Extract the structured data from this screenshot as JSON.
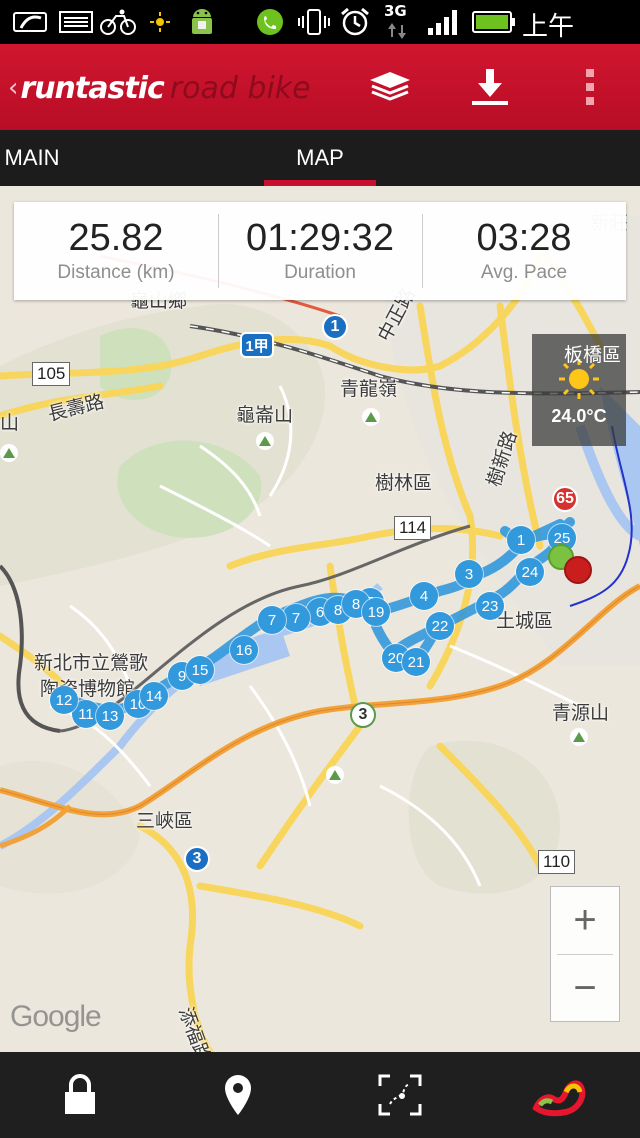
{
  "status_bar": {
    "network": "3G",
    "time": "上午11:11",
    "icons": [
      "photo-icon",
      "mail-icon",
      "cycling-icon",
      "sun-icon",
      "android-icon",
      "phone-icon",
      "vibrate-icon",
      "alarm-icon",
      "signal-icon",
      "battery-icon"
    ]
  },
  "app_bar": {
    "brand_primary": "runtastic",
    "brand_secondary": "road bike",
    "actions": [
      "layers-icon",
      "download-icon",
      "overflow-menu-icon"
    ],
    "color": "#c8102e"
  },
  "tabs": [
    {
      "label": "MAIN",
      "active": false
    },
    {
      "label": "MAP",
      "active": true
    }
  ],
  "stats": [
    {
      "value": "25.82",
      "label": "Distance (km)"
    },
    {
      "value": "01:29:32",
      "label": "Duration"
    },
    {
      "value": "03:28",
      "label": "Avg. Pace"
    }
  ],
  "weather": {
    "temp": "24.0°C",
    "icon": "sun-icon"
  },
  "map": {
    "labels": {
      "banqiao": "板橋區",
      "shulin": "樹林區",
      "tucheng": "土城區",
      "sanxia": "三峽區",
      "qingyuan": "青源山",
      "qinglong": "青龍嶺",
      "guilun": "龜崙山",
      "changshou": "長壽路",
      "zhongzheng": "中正路",
      "shuxin": "樹新路",
      "yongfu": "添福路",
      "guishan": "龜山鄉",
      "museum1": "新北市立鶯歌",
      "museum2": "陶瓷博物館",
      "xinzhuang": "新莊",
      "shan_partial": "山"
    },
    "road_numbers": {
      "r105": "105",
      "r114": "114",
      "r110": "110",
      "r65": "65",
      "r1": "1",
      "r1jia": "1甲",
      "r3a": "3",
      "r3b": "3"
    },
    "route_markers": [
      "1",
      "3",
      "4",
      "5",
      "6",
      "7",
      "7",
      "8",
      "8",
      "9",
      "10",
      "11",
      "12",
      "13",
      "14",
      "15",
      "16",
      "19",
      "20",
      "21",
      "22",
      "23",
      "24",
      "25"
    ],
    "route_color": "#3399dd",
    "zoom_in": "+",
    "zoom_out": "−",
    "attribution": "Google"
  },
  "bottom_bar": {
    "items": [
      "lock-icon",
      "location-pin-icon",
      "fullscreen-map-icon",
      "route-logo-icon"
    ]
  }
}
